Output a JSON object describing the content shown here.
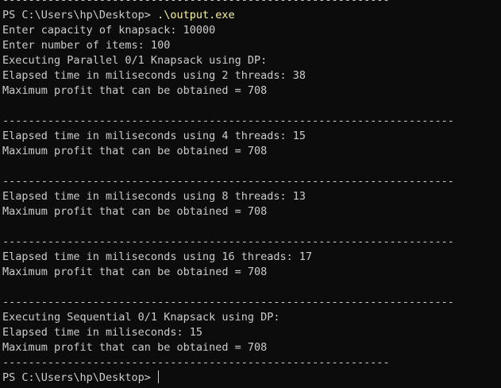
{
  "terminal": {
    "sep_short": "------------------------------------------------------------",
    "sep_long": "----------------------------------------------------------------------",
    "prompt": "PS C:\\Users\\hp\\Desktop> ",
    "command": ".\\output.exe",
    "capacity": "Enter capacity of knapsack: 10000",
    "items": "Enter number of items: 100",
    "parallel_header": "Executing Parallel 0/1 Knapsack using DP:",
    "runs": [
      {
        "time": "Elapsed time in miliseconds using 2 threads: 38",
        "profit": "Maximum profit that can be obtained = 708"
      },
      {
        "time": "Elapsed time in miliseconds using 4 threads: 15",
        "profit": "Maximum profit that can be obtained = 708"
      },
      {
        "time": "Elapsed time in miliseconds using 8 threads: 13",
        "profit": "Maximum profit that can be obtained = 708"
      },
      {
        "time": "Elapsed time in miliseconds using 16 threads: 17",
        "profit": "Maximum profit that can be obtained = 708"
      }
    ],
    "sequential_header": "Executing Sequential 0/1 Knapsack using DP:",
    "sequential_time": "Elapsed time in miliseconds: 15",
    "sequential_profit": "Maximum profit that can be obtained = 708",
    "final_prompt": "PS C:\\Users\\hp\\Desktop> "
  }
}
